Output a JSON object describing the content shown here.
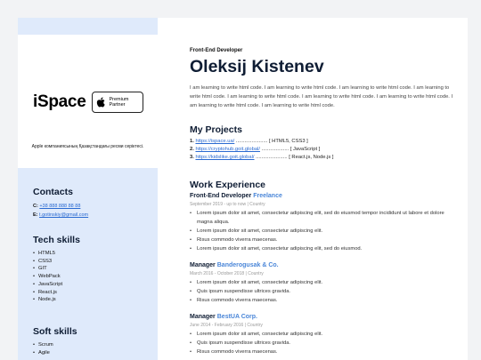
{
  "logo": {
    "brand": "iSpace",
    "badge_line1": "Premium",
    "badge_line2": "Partner",
    "caption": "Apple компаниясының Қазақстандағы ресми серіктесі."
  },
  "contacts": {
    "heading": "Contacts",
    "phone_label": "C:",
    "phone": "+38 888 888 88 88",
    "email_label": "E:",
    "email": "t.gotinskiy@gmail.com"
  },
  "tech_skills": {
    "heading": "Tech skills",
    "items": [
      "HTML5",
      "CSS3",
      "GIT",
      "WebPack",
      "JavaScript",
      "React.js",
      "Node.js"
    ]
  },
  "soft_skills": {
    "heading": "Soft skills",
    "items": [
      "Scrum",
      "Agile"
    ]
  },
  "header": {
    "role": "Front-End Developer",
    "name": "Oleksij Kistenev",
    "intro": "I am learning to write html code. I am learning to write html code. I am learning to write html code. I am learning to write html code. I am learning to write html code. I am learning to write html code. I am learning to write html code. I am learning to write html code. I am learning to write html code."
  },
  "projects": {
    "heading": "My Projects",
    "items": [
      {
        "num": "1.",
        "url": "https://ispace.ua/",
        "dots": " ...................... ",
        "tech": "[ HTML5, CSS3 ]"
      },
      {
        "num": "2.",
        "url": "https://cryptohub.goit.global/",
        "dots": " ................... ",
        "tech": "[ JavaScript ]"
      },
      {
        "num": "3.",
        "url": "https://kidslike.goit.global/",
        "dots": " ...................... ",
        "tech": "[ React.js, Node.js ]"
      }
    ]
  },
  "experience": {
    "heading": "Work Experience",
    "jobs": [
      {
        "title": "Front-End Developer",
        "company": "Freelance",
        "date": "September 2019 - up to now | Country",
        "bullets": [
          "Lorem ipsum dolor sit amet, consectetur adipiscing elit, sed do eiusmod tempor incididunt ut labore et dolore magna aliqua.",
          "Lorem ipsum dolor sit amet, consectetur adipiscing elit.",
          "Risus commodo viverra maecenas.",
          "Lorem ipsum dolor sit amet, consectetur adipiscing elit, sed do eiusmod."
        ]
      },
      {
        "title": "Manager",
        "company": "Banderogusak & Co.",
        "date": "March 2016 - October 2018 | Country",
        "bullets": [
          "Lorem ipsum dolor sit amet, consectetur adipiscing elit.",
          "Quis ipsum suspendisse ultrices gravida.",
          "Risus commodo viverra maecenas."
        ]
      },
      {
        "title": "Manager",
        "company": "BestUA Corp.",
        "date": "June 2014 - February 2016 | Country",
        "bullets": [
          "Lorem ipsum dolor sit amet, consectetur adipiscing elit.",
          "Quis ipsum suspendisse ultrices gravida.",
          "Risus commodo viverra maecenas."
        ]
      }
    ]
  }
}
